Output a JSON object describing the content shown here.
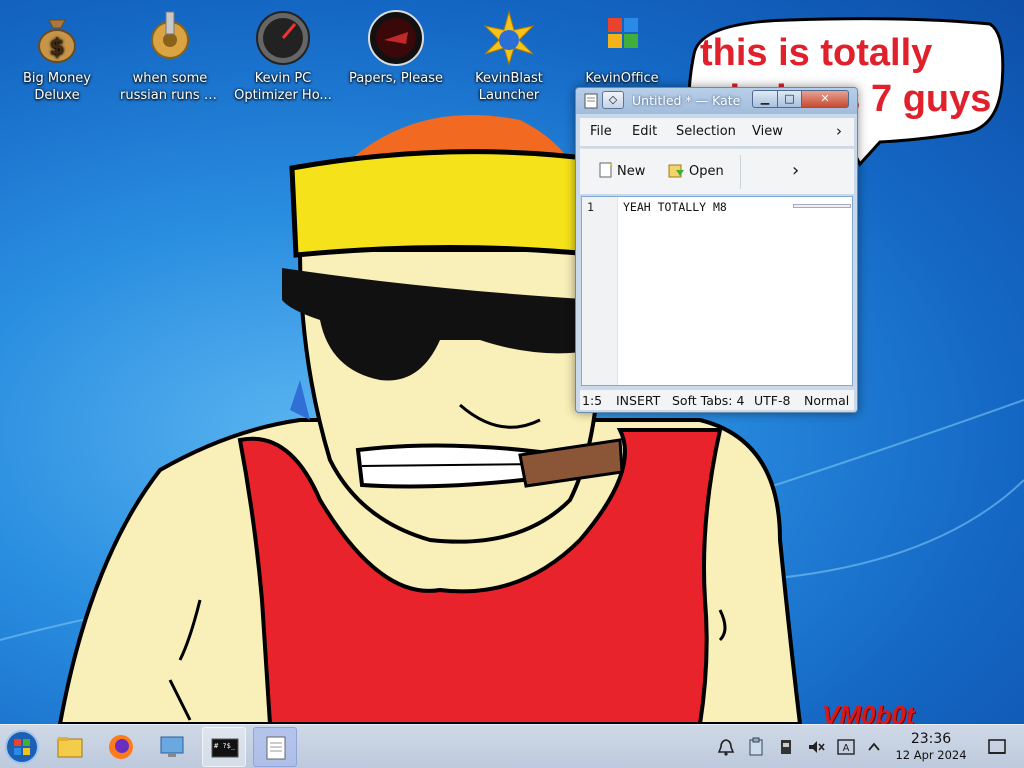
{
  "desktop": {
    "icons": [
      {
        "label_line1": "Big Money",
        "label_line2": "Deluxe",
        "icon": "money-bag-icon"
      },
      {
        "label_line1": "when some",
        "label_line2": "russian runs a...",
        "icon": "gear-icon"
      },
      {
        "label_line1": "Kevin PC",
        "label_line2": "Optimizer Ho...",
        "icon": "speedometer-icon"
      },
      {
        "label_line1": "Papers, Please",
        "label_line2": "",
        "icon": "papers-please-icon"
      },
      {
        "label_line1": "KevinBlast",
        "label_line2": "Launcher",
        "icon": "star-burst-icon"
      },
      {
        "label_line1": "KevinOffice",
        "label_line2": "",
        "icon": "office-icon"
      }
    ],
    "bubble_line1": "this is totally",
    "bubble_line2": "windows 7 guys",
    "watermark": "VM0b0t",
    "colors": {
      "bubble_text": "#e0202a",
      "shirt": "#e8232b",
      "headband": "#f5e21a",
      "skin": "#f9efb8"
    }
  },
  "editor": {
    "title": "Untitled * — Kate",
    "menu": {
      "file": "File",
      "edit": "Edit",
      "selection": "Selection",
      "view": "View"
    },
    "toolbar": {
      "new_label": "New",
      "open_label": "Open"
    },
    "gutter_line": "1",
    "text": "YEAH TOTALLY M8",
    "status": {
      "cursor": "1:5",
      "mode": "INSERT",
      "tabs": "Soft Tabs: 4",
      "encoding": "UTF-8",
      "view_mode": "Normal"
    }
  },
  "taskbar": {
    "clock_time": "23:36",
    "clock_date": "12 Apr 2024",
    "terminal_label": "# ?$_"
  }
}
